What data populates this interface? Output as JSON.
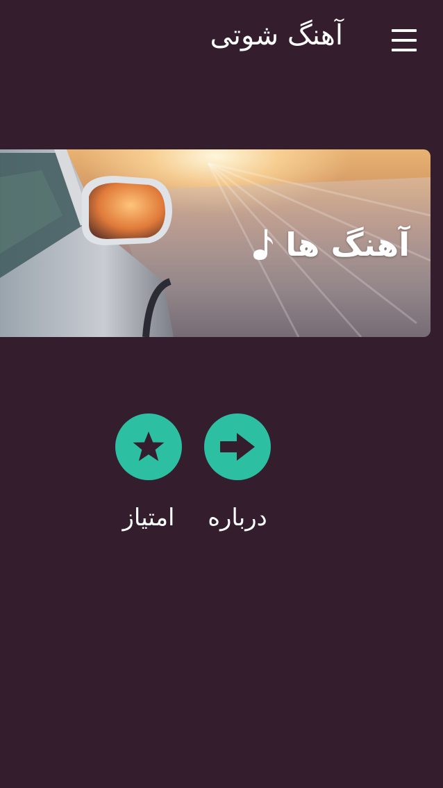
{
  "header": {
    "title": "آهنگ شوتی",
    "menu_icon": "hamburger-menu-icon"
  },
  "banner": {
    "label": "آهنگ ها",
    "icon": "music-note-icon"
  },
  "actions": [
    {
      "label": "امتیاز",
      "icon": "star-icon"
    },
    {
      "label": "درباره",
      "icon": "arrow-right-icon"
    }
  ],
  "colors": {
    "background": "#341e2e",
    "accent": "#2dbfa2",
    "text": "#ffffff"
  }
}
